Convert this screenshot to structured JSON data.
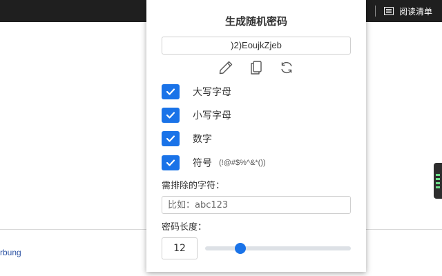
{
  "browser": {
    "reading_list_label": "阅读清单",
    "reading_list_icon": "reading-list-icon"
  },
  "background_page": {
    "link_text": "rbung"
  },
  "popup": {
    "title": "生成随机密码",
    "password": ")2)EoujkZjeb",
    "tools": [
      {
        "name": "edit",
        "icon": "pencil-icon"
      },
      {
        "name": "copy",
        "icon": "copy-icon"
      },
      {
        "name": "regenerate",
        "icon": "refresh-icon"
      }
    ],
    "options": [
      {
        "label": "大写字母",
        "checked": true,
        "hint": ""
      },
      {
        "label": "小写字母",
        "checked": true,
        "hint": ""
      },
      {
        "label": "数字",
        "checked": true,
        "hint": ""
      },
      {
        "label": "符号",
        "checked": true,
        "hint": "(!@#$%^&*())"
      }
    ],
    "exclude": {
      "label": "需排除的字符：",
      "placeholder": "比如：abc123",
      "value": ""
    },
    "length": {
      "label": "密码长度：",
      "value": "12",
      "slider_fraction": 0.24
    },
    "colors": {
      "accent": "#1a73e8",
      "text": "#333333",
      "border": "#cfcfcf"
    }
  }
}
